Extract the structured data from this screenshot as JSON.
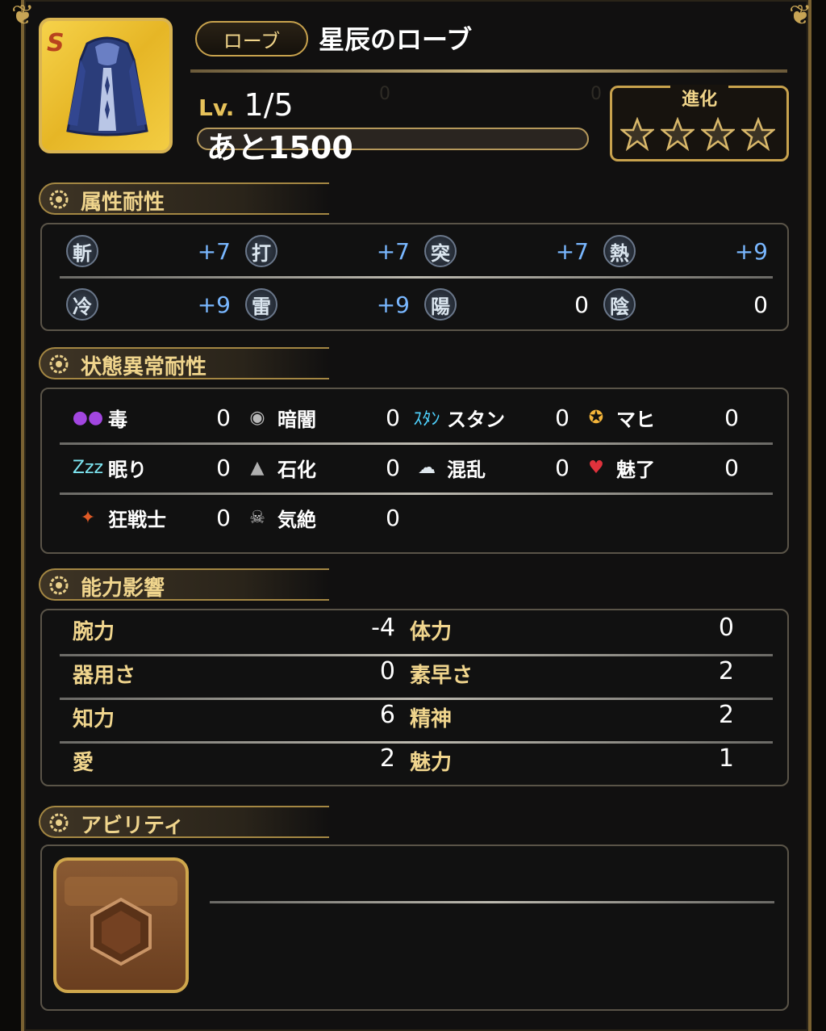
{
  "item": {
    "type": "ローブ",
    "name": "星辰のローブ",
    "level_prefix": "Lv.",
    "level": "1/5",
    "exp_remaining": "あと1500",
    "exp_progress": 0.0,
    "icon": "blue-robe-icon",
    "rarity_mark": "S"
  },
  "evolution": {
    "label": "進化",
    "stars_total": 4,
    "stars_filled": 0
  },
  "sections": {
    "element": "属性耐性",
    "status": "状態異常耐性",
    "ability": "能力影響",
    "skills": "アビリティ"
  },
  "elements": [
    {
      "glyph": "斬",
      "value": "+7",
      "color": "#79b7ff",
      "icon": "slash-icon"
    },
    {
      "glyph": "打",
      "value": "+7",
      "color": "#79b7ff",
      "icon": "blunt-icon"
    },
    {
      "glyph": "突",
      "value": "+7",
      "color": "#79b7ff",
      "icon": "pierce-icon"
    },
    {
      "glyph": "熱",
      "value": "+9",
      "color": "#79b7ff",
      "icon": "heat-icon"
    },
    {
      "glyph": "冷",
      "value": "+9",
      "color": "#79b7ff",
      "icon": "cold-icon"
    },
    {
      "glyph": "雷",
      "value": "+9",
      "color": "#79b7ff",
      "icon": "thunder-icon"
    },
    {
      "glyph": "陽",
      "value": "0",
      "color": "#ffffff",
      "icon": "light-icon"
    },
    {
      "glyph": "陰",
      "value": "0",
      "color": "#ffffff",
      "icon": "dark-icon"
    }
  ],
  "statuses": [
    {
      "label": "毒",
      "value": "0",
      "icon": "poison-icon"
    },
    {
      "label": "暗闇",
      "value": "0",
      "icon": "blind-eye-icon"
    },
    {
      "label": "スタン",
      "value": "0",
      "icon": "stun-icon"
    },
    {
      "label": "マヒ",
      "value": "0",
      "icon": "paralysis-icon"
    },
    {
      "label": "眠り",
      "value": "0",
      "icon": "sleep-zzz-icon"
    },
    {
      "label": "石化",
      "value": "0",
      "icon": "petrify-rock-icon"
    },
    {
      "label": "混乱",
      "value": "0",
      "icon": "confusion-icon"
    },
    {
      "label": "魅了",
      "value": "0",
      "icon": "charm-heart-icon"
    },
    {
      "label": "狂戦士",
      "value": "0",
      "icon": "berserk-icon"
    },
    {
      "label": "気絶",
      "value": "0",
      "icon": "faint-skull-icon"
    }
  ],
  "stats": [
    {
      "label": "腕力",
      "value": "-4"
    },
    {
      "label": "体力",
      "value": "0"
    },
    {
      "label": "器用さ",
      "value": "0"
    },
    {
      "label": "素早さ",
      "value": "2"
    },
    {
      "label": "知力",
      "value": "6"
    },
    {
      "label": "精神",
      "value": "2"
    },
    {
      "label": "愛",
      "value": "2"
    },
    {
      "label": "魅力",
      "value": "1"
    }
  ],
  "ability_slot": {
    "icon": "empty-gem-icon"
  },
  "colors": {
    "gold": "#c8a24d",
    "positive": "#79b7ff",
    "label_gold": "#f0d58d"
  }
}
